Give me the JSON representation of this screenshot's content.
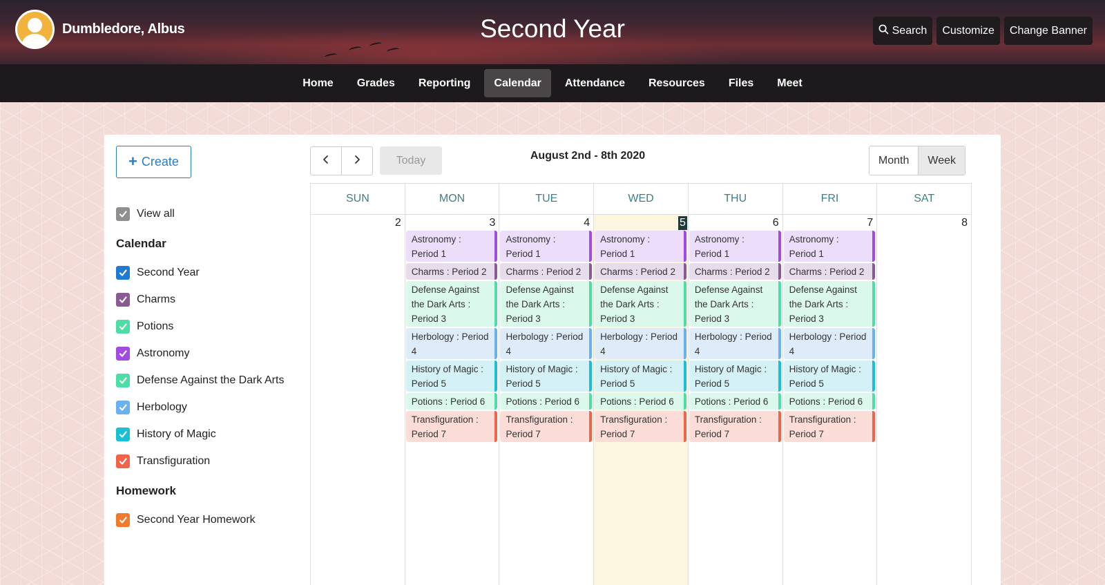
{
  "header": {
    "user_name": "Dumbledore, Albus",
    "title": "Second Year",
    "buttons": {
      "search": "Search",
      "customize": "Customize",
      "change_banner": "Change Banner"
    }
  },
  "nav": [
    {
      "label": "Home",
      "active": false
    },
    {
      "label": "Grades",
      "active": false
    },
    {
      "label": "Reporting",
      "active": false
    },
    {
      "label": "Calendar",
      "active": true
    },
    {
      "label": "Attendance",
      "active": false
    },
    {
      "label": "Resources",
      "active": false
    },
    {
      "label": "Files",
      "active": false
    },
    {
      "label": "Meet",
      "active": false
    }
  ],
  "sidebar": {
    "create_label": "Create",
    "view_all": {
      "label": "View all",
      "color": "#8f8f8f"
    },
    "calendar_heading": "Calendar",
    "calendars": [
      {
        "label": "Second Year",
        "color": "#1f7ad1"
      },
      {
        "label": "Charms",
        "color": "#8a5a94"
      },
      {
        "label": "Potions",
        "color": "#4fdda7"
      },
      {
        "label": "Astronomy",
        "color": "#a24be3"
      },
      {
        "label": "Defense Against the Dark Arts",
        "color": "#4fdda7"
      },
      {
        "label": "Herbology",
        "color": "#6ab2ee"
      },
      {
        "label": "History of Magic",
        "color": "#19bfd3"
      },
      {
        "label": "Transfiguration",
        "color": "#f0644a"
      }
    ],
    "homework_heading": "Homework",
    "homework": [
      {
        "label": "Second Year Homework",
        "color": "#f2792b"
      }
    ]
  },
  "toolbar": {
    "today_label": "Today",
    "range_label": "August 2nd - 8th 2020",
    "month_label": "Month",
    "week_label": "Week",
    "active_view": "Week"
  },
  "week": {
    "days": [
      {
        "dow": "SUN",
        "num": "2",
        "today": false,
        "has_events": false
      },
      {
        "dow": "MON",
        "num": "3",
        "today": false,
        "has_events": true
      },
      {
        "dow": "TUE",
        "num": "4",
        "today": false,
        "has_events": true
      },
      {
        "dow": "WED",
        "num": "5",
        "today": true,
        "has_events": true
      },
      {
        "dow": "THU",
        "num": "6",
        "today": false,
        "has_events": true
      },
      {
        "dow": "FRI",
        "num": "7",
        "today": false,
        "has_events": true
      },
      {
        "dow": "SAT",
        "num": "8",
        "today": false,
        "has_events": false
      }
    ],
    "events": [
      {
        "text": "Astronomy : Period 1",
        "bg": "#ecdefa",
        "border": "#a24be3"
      },
      {
        "text": "Charms : Period 2",
        "bg": "#e6dceb",
        "border": "#8a5a94"
      },
      {
        "text": "Defense Against the Dark Arts : Period 3",
        "bg": "#dbf8ec",
        "border": "#4fdda7"
      },
      {
        "text": "Herbology : Period 4",
        "bg": "#deebf8",
        "border": "#6ab2ee"
      },
      {
        "text": "History of Magic : Period 5",
        "bg": "#d4f1f5",
        "border": "#19bfd3"
      },
      {
        "text": "Potions : Period 6",
        "bg": "#dbf8ec",
        "border": "#4fdda7"
      },
      {
        "text": "Transfiguration : Period 7",
        "bg": "#fcdcd6",
        "border": "#f0644a"
      }
    ]
  }
}
